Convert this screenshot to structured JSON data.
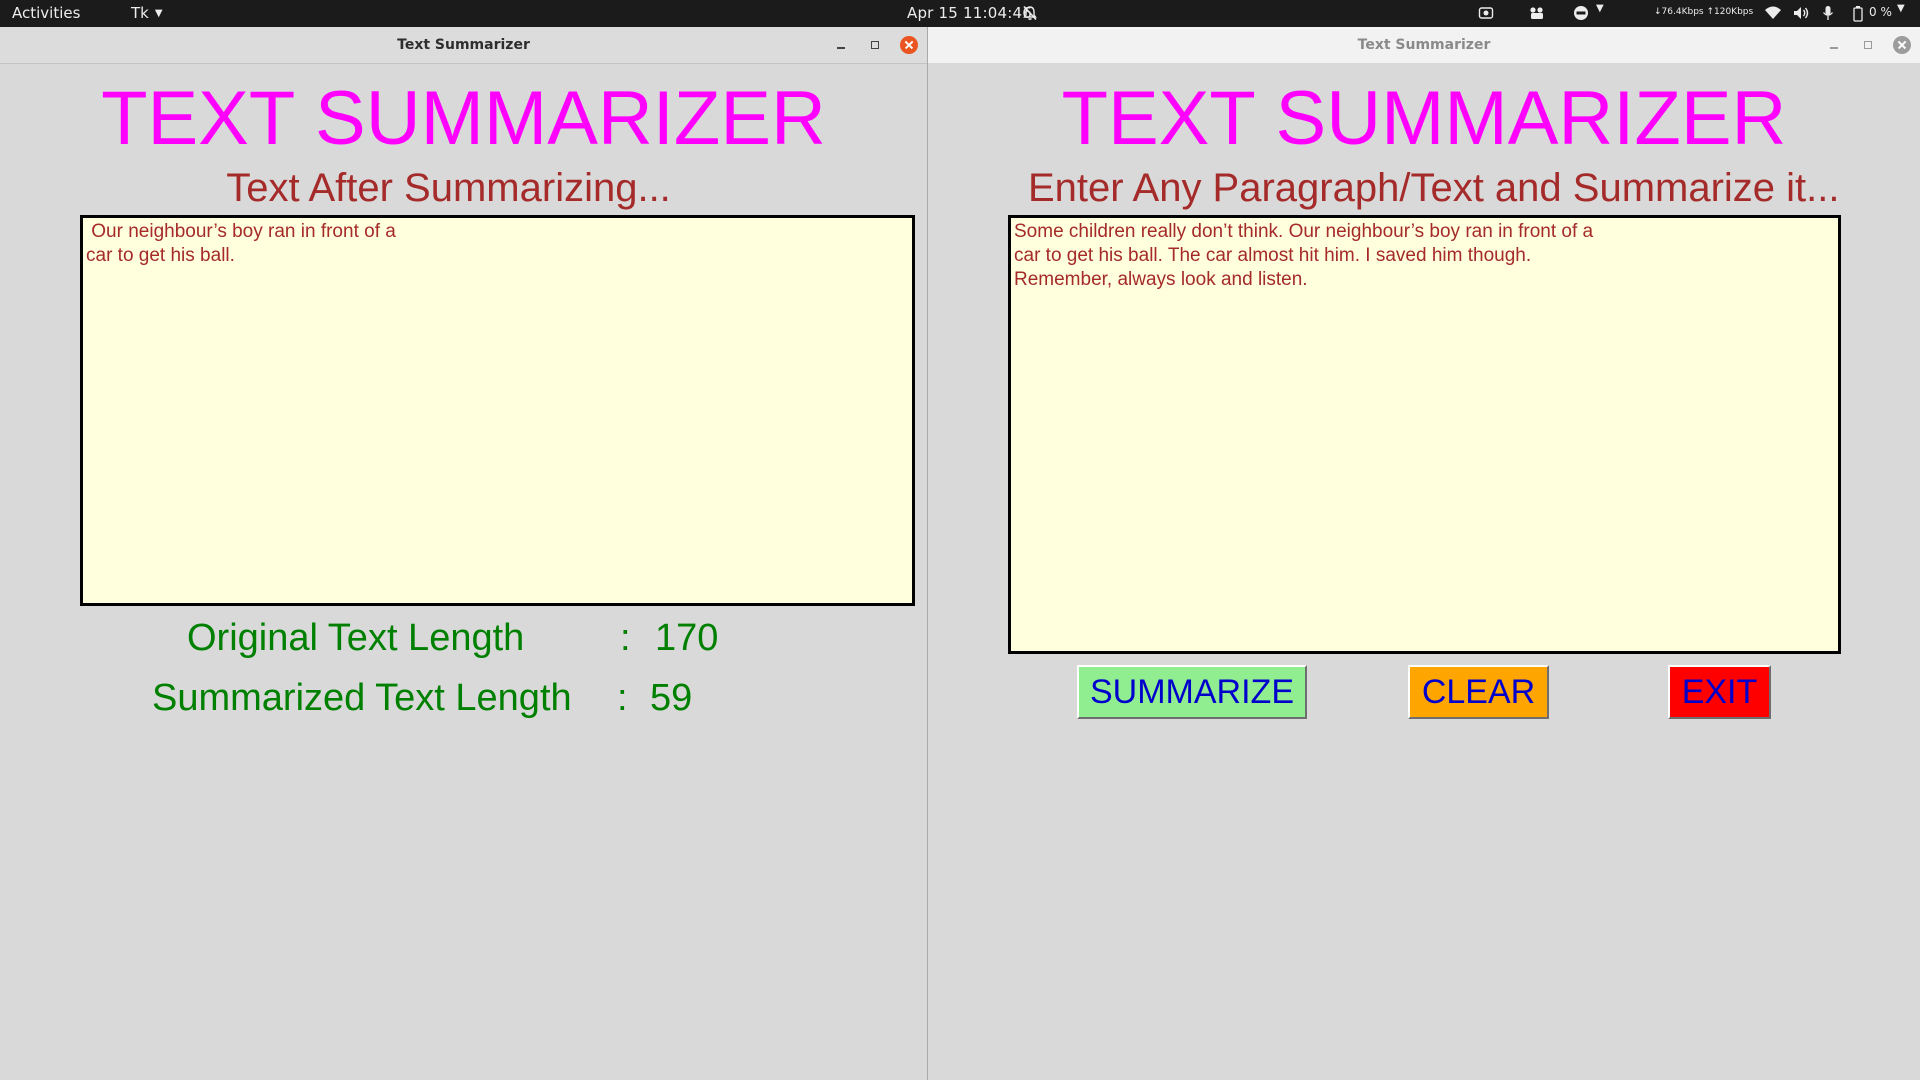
{
  "topbar": {
    "activities": "Activities",
    "app_menu": "Tk",
    "clock": "Apr 15  11:04:46",
    "net_speed": "↓76.4Kbps ↑120Kbps",
    "battery": "0 %",
    "icons": [
      "bell-muted-icon",
      "screenshot-icon",
      "settings-icon",
      "accessibility-icon",
      "wifi-icon",
      "volume-icon",
      "microphone-icon",
      "battery-icon"
    ]
  },
  "left_window": {
    "title": "Text Summarizer",
    "app_title": "TEXT SUMMARIZER",
    "subtitle": "Text After Summarizing...",
    "output_text": " Our neighbour’s boy ran in front of a\ncar to get his ball.",
    "stats": {
      "original_label": "Original Text Length",
      "original_value": "170",
      "summarized_label": "Summarized Text Length",
      "summarized_value": "59",
      "separator": ":"
    }
  },
  "right_window": {
    "title": "Text Summarizer",
    "app_title": "TEXT SUMMARIZER",
    "subtitle": "Enter Any Paragraph/Text and Summarize it...",
    "input_text": "Some children really don’t think. Our neighbour’s boy ran in front of a\ncar to get his ball. The car almost hit him. I saved him though.\nRemember, always look and listen.",
    "buttons": {
      "summarize": "SUMMARIZE",
      "clear": "CLEAR",
      "exit": "EXIT"
    }
  },
  "colors": {
    "app_title": "#ff00ff",
    "subtitle": "#a52a2a",
    "stats_text": "#008000",
    "textbox_bg": "#ffffdd",
    "button_text": "#0000cd",
    "summarize_bg": "#90ee90",
    "clear_bg": "#ffa500",
    "exit_bg": "#ff0000",
    "close_button": "#e95420"
  }
}
